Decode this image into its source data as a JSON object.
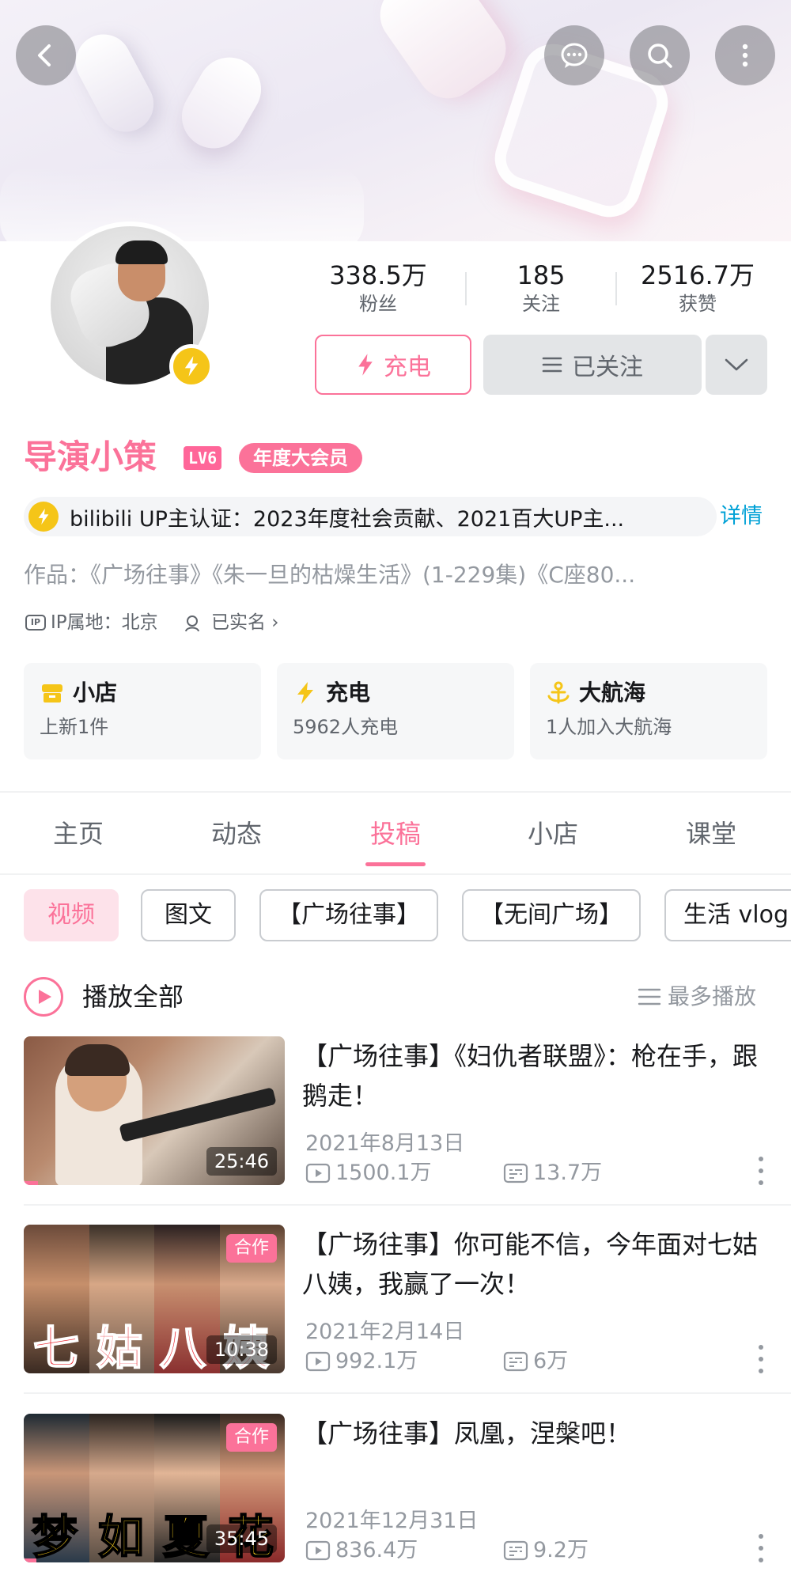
{
  "header": {
    "back_icon": "back-arrow-icon",
    "chat_icon": "message-icon",
    "search_icon": "search-icon",
    "more_icon": "more-vertical-icon"
  },
  "profile": {
    "stats": [
      {
        "value": "338.5万",
        "label": "粉丝"
      },
      {
        "value": "185",
        "label": "关注"
      },
      {
        "value": "2516.7万",
        "label": "获赞"
      }
    ],
    "charge_label": "充电",
    "follow_label": "已关注",
    "username": "导演小策",
    "level": "LV6",
    "vip_badge": "年度大会员",
    "certification": "bilibili UP主认证：2023年度社会贡献、2021百大UP主...",
    "certification_more": "详情",
    "works": "作品：《广场往事》《朱一旦的枯燥生活》(1-229集)《C座80...",
    "ip_label": "IP属地：北京",
    "realname_label": "已实名"
  },
  "cards": [
    {
      "title": "小店",
      "subtitle": "上新1件",
      "icon": "shop-icon"
    },
    {
      "title": "充电",
      "subtitle": "5962人充电",
      "icon": "lightning-icon"
    },
    {
      "title": "大航海",
      "subtitle": "1人加入大航海",
      "icon": "anchor-icon"
    }
  ],
  "tabs": [
    "主页",
    "动态",
    "投稿",
    "小店",
    "课堂"
  ],
  "active_tab": "投稿",
  "chips": [
    "视频",
    "图文",
    "【广场往事】",
    "【无间广场】",
    "生活 vlog"
  ],
  "play_all_label": "播放全部",
  "sort_label": "最多播放",
  "videos": [
    {
      "title": "【广场往事】《妇仇者联盟》：枪在手，跟鹅走！",
      "date": "2021年8月13日",
      "plays": "1500.1万",
      "danmaku": "13.7万",
      "duration": "25:46",
      "badge": ""
    },
    {
      "title": "【广场往事】你可能不信，今年面对七姑八姨，我赢了一次！",
      "date": "2021年2月14日",
      "plays": "992.1万",
      "danmaku": "6万",
      "duration": "10:38",
      "badge": "合作",
      "thumb_text": [
        "七",
        "姑",
        "八",
        "姨"
      ]
    },
    {
      "title": "【广场往事】凤凰，涅槃吧！",
      "date": "2021年12月31日",
      "plays": "836.4万",
      "danmaku": "9.2万",
      "duration": "35:45",
      "badge": "合作",
      "thumb_text": [
        "梦",
        "如",
        "夏",
        "花"
      ]
    }
  ],
  "colors": {
    "accent": "#fb7299",
    "link": "#00a1d6",
    "gold": "#f5c518"
  }
}
